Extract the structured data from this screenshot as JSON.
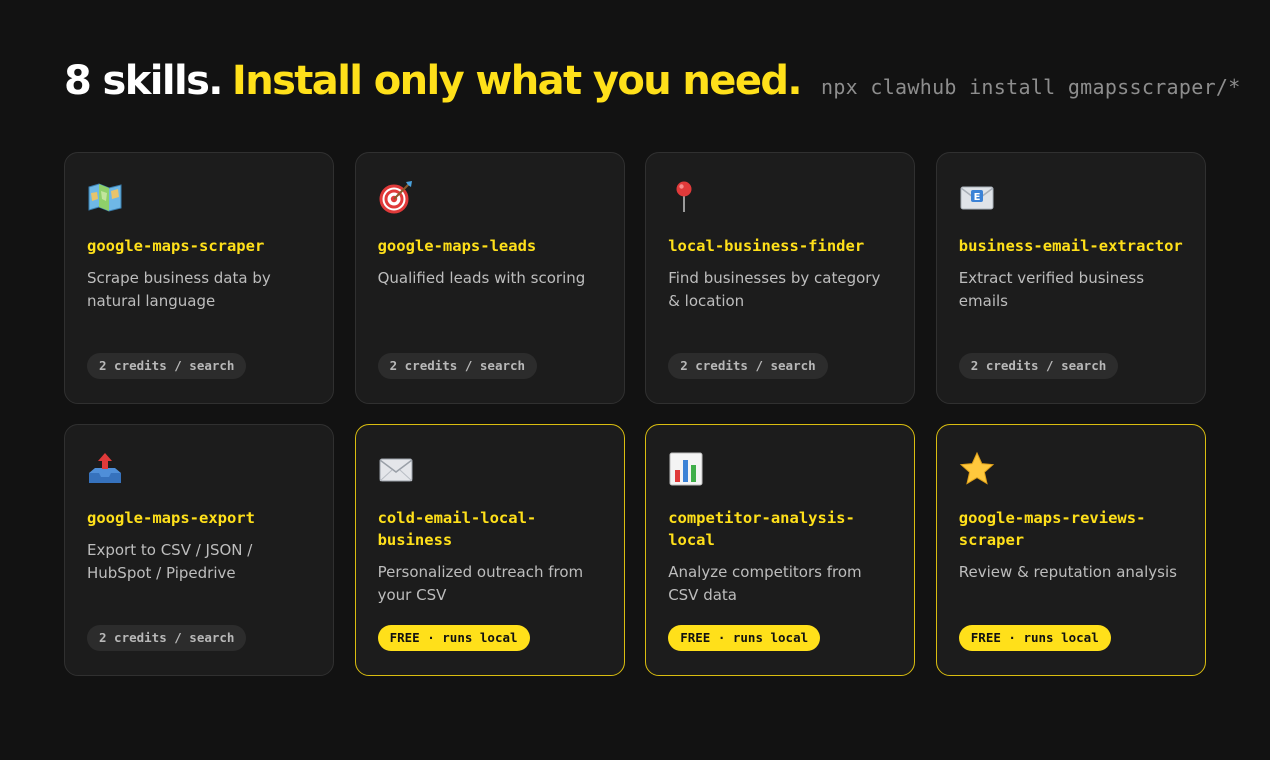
{
  "header": {
    "title_white": "8 skills.",
    "title_yellow": "Install only what you need.",
    "command": "npx clawhub install gmapsscraper/*"
  },
  "colors": {
    "background": "#121212",
    "card": "#1c1c1c",
    "accent": "#ffe01a",
    "muted_text": "#bdbdbd"
  },
  "cards": [
    {
      "icon": "map-icon",
      "title": "google-maps-scraper",
      "desc": "Scrape business data by natural language",
      "badge": "2 credits / search",
      "free": false
    },
    {
      "icon": "target-icon",
      "title": "google-maps-leads",
      "desc": "Qualified leads with scoring",
      "badge": "2 credits / search",
      "free": false
    },
    {
      "icon": "pin-icon",
      "title": "local-business-finder",
      "desc": "Find businesses by category & location",
      "badge": "2 credits / search",
      "free": false
    },
    {
      "icon": "email-envelope-icon",
      "title": "business-email-extractor",
      "desc": "Extract verified business emails",
      "badge": "2 credits / search",
      "free": false
    },
    {
      "icon": "outbox-tray-icon",
      "title": "google-maps-export",
      "desc": "Export to CSV / JSON / HubSpot / Pipedrive",
      "badge": "2 credits / search",
      "free": false
    },
    {
      "icon": "envelope-icon",
      "title": "cold-email-local-business",
      "desc": "Personalized outreach from your CSV",
      "badge": "FREE · runs local",
      "free": true
    },
    {
      "icon": "bar-chart-icon",
      "title": "competitor-analysis-local",
      "desc": "Analyze competitors from CSV data",
      "badge": "FREE · runs local",
      "free": true
    },
    {
      "icon": "star-icon",
      "title": "google-maps-reviews-scraper",
      "desc": "Review & reputation analysis",
      "badge": "FREE · runs local",
      "free": true
    }
  ]
}
